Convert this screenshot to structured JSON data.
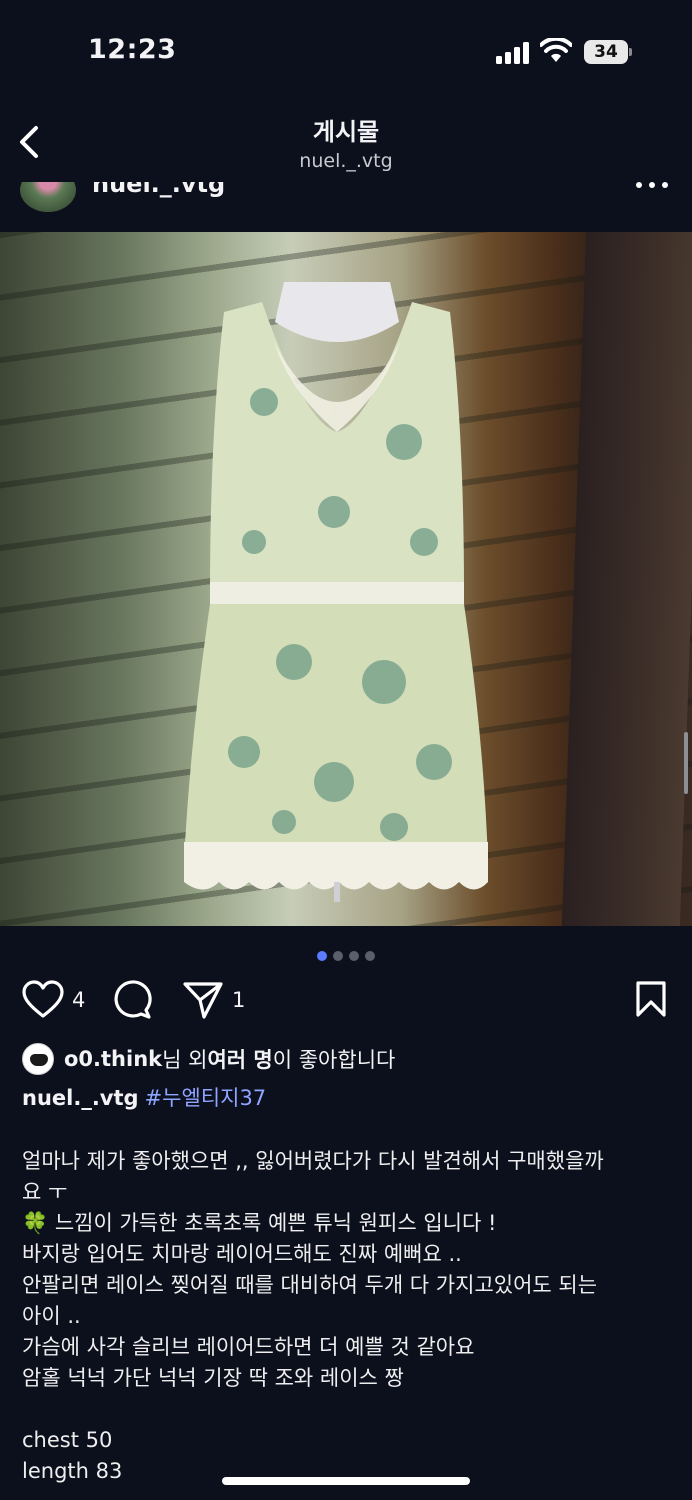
{
  "status": {
    "time": "12:23",
    "battery": "34"
  },
  "nav": {
    "title": "게시물",
    "subtitle": "nuel._.vtg"
  },
  "post": {
    "username": "nuel._.vtg",
    "image_index": 1,
    "image_count": 4
  },
  "actions": {
    "like_count": "4",
    "share_count": "1"
  },
  "likes": {
    "user": "o0.think",
    "suffix_1": "님 외 ",
    "bold_part": "여러 명",
    "suffix_2": "이 좋아합니다"
  },
  "caption": {
    "username": "nuel._.vtg",
    "hashtag": "#누엘티지37"
  },
  "body_lines": [
    "얼마나 제가 좋아했으면 ,, 잃어버렸다가 다시 발견해서 구매했을까",
    "요 ㅜ",
    "🍀 느낌이 가득한 초록초록 예쁜 튜닉 원피스 입니다 !",
    "바지랑 입어도 치마랑 레이어드해도 진짜 예뻐요 ..",
    "안팔리면 레이스 찢어질 때를 대비하여 두개 다 가지고있어도 되는",
    "아이 ..",
    "가슴에 사각 슬리브 레이어드하면 더 예쁠 것 같아요",
    "암홀 넉넉 가단 넉넉 기장 딱 조와 레이스 짱",
    "",
    "chest 50",
    "length 83"
  ]
}
